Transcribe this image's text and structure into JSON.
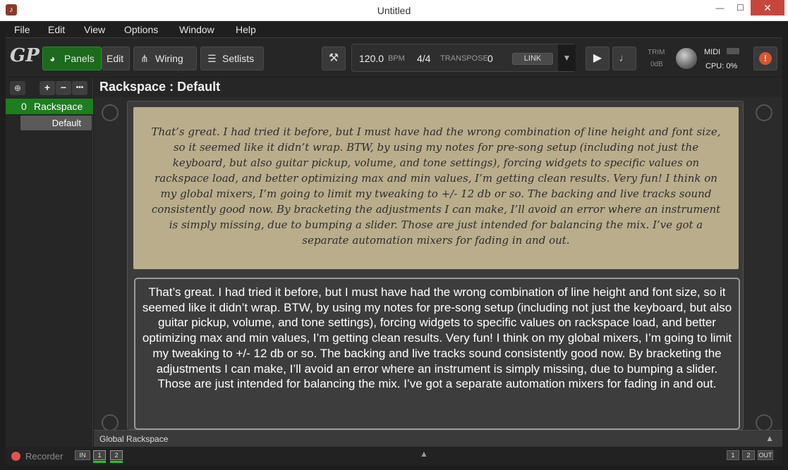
{
  "window": {
    "title": "Untitled",
    "minimize": "—",
    "maximize": "☐",
    "close": "✕"
  },
  "menu": [
    "File",
    "Edit",
    "View",
    "Options",
    "Window",
    "Help"
  ],
  "toolbar": {
    "logo": "GP",
    "panels_label": "Panels",
    "edit_label": "Edit",
    "wiring_label": "Wiring",
    "setlists_label": "Setlists",
    "bpm_value": "120.0",
    "bpm_label": "BPM",
    "time_signature": "4/4",
    "transpose_label": "TRANSPOSE",
    "transpose_value": "0",
    "link_label": "LINK",
    "trim_label": "TRIM",
    "trim_value": "0dB",
    "midi_label": "MIDI",
    "cpu_label": "CPU: 0%"
  },
  "sidebar": {
    "rackspaces": [
      {
        "number": "0",
        "name": "Rackspace",
        "variations": [
          "Default"
        ]
      }
    ]
  },
  "main": {
    "rackspace_title": "Rackspace : Default",
    "note_text": "That’s great. I had tried it before, but I must have had the wrong combination of line height and font size, so it seemed like it didn’t wrap.     BTW, by using my notes for pre-song setup (including not just the keyboard, but also guitar pickup, volume, and tone settings), forcing widgets to specific values on rackspace load, and better optimizing max and min values, I’m getting clean results. Very fun!    I think on my global mixers, I’m going to limit my tweaking to +/- 12 db or so. The backing and live tracks sound consistently good now. By bracketing the adjustments I can make, I’ll avoid an error where an instrument is simply missing, due to bumping a slider. Those are just intended for balancing the mix. I’ve got a separate automation mixers for fading in and out.",
    "global_rackspace_label": "Global Rackspace"
  },
  "statusbar": {
    "recorder_label": "Recorder",
    "in_label": "IN",
    "in_channels": [
      "1",
      "2"
    ],
    "out_channels": [
      "1",
      "2"
    ],
    "out_label": "OUT"
  },
  "colors": {
    "accent_green": "#1e7d1e",
    "parchment": "#b9ad8c",
    "close_red": "#c7463c"
  }
}
